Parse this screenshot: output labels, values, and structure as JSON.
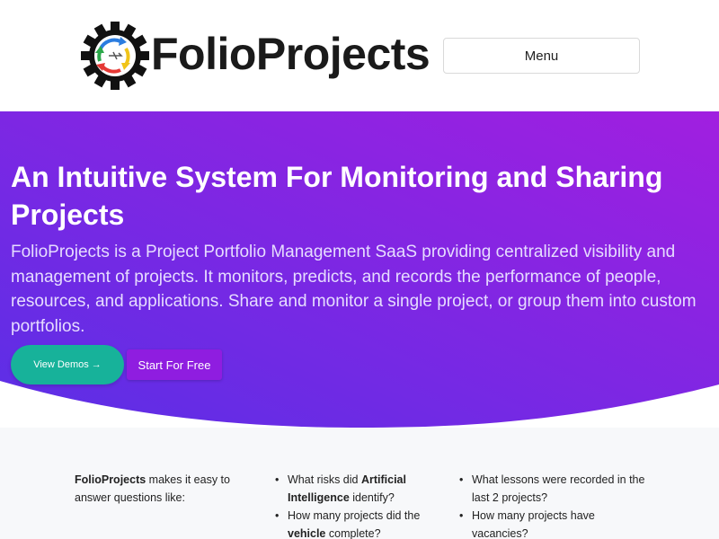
{
  "header": {
    "brand": "FolioProjects",
    "menu_label": "Menu",
    "logo_icon": "gear-cycle-logo-icon"
  },
  "hero": {
    "title": "An Intuitive System For Monitoring and Sharing Projects",
    "description": "FolioProjects is a Project Portfolio Management SaaS providing centralized visibility and management of projects. It monitors, predicts, and records the performance of people, resources, and applications. Share and monitor a single project, or group them into custom portfolios.",
    "demos_label": "View Demos",
    "demos_arrow": "→",
    "free_label": "Start For Free",
    "gradient_start": "#5a2fe6",
    "gradient_end": "#a11fe0",
    "demos_color": "#17b29a",
    "free_color": "#8f1de0"
  },
  "questions": {
    "intro_brand": "FolioProjects",
    "intro_text": " makes it easy to answer questions like:",
    "col2": [
      {
        "pre": "What risks did ",
        "bold": "Artificial Intelligence",
        "post": " identify?"
      },
      {
        "pre": "How many projects did the ",
        "bold": "vehicle",
        "post": " complete?"
      }
    ],
    "col3": [
      {
        "pre": "What lessons were recorded in the last 2 projects?",
        "bold": "",
        "post": ""
      },
      {
        "pre": "How many projects have vacancies?",
        "bold": "",
        "post": ""
      }
    ]
  }
}
